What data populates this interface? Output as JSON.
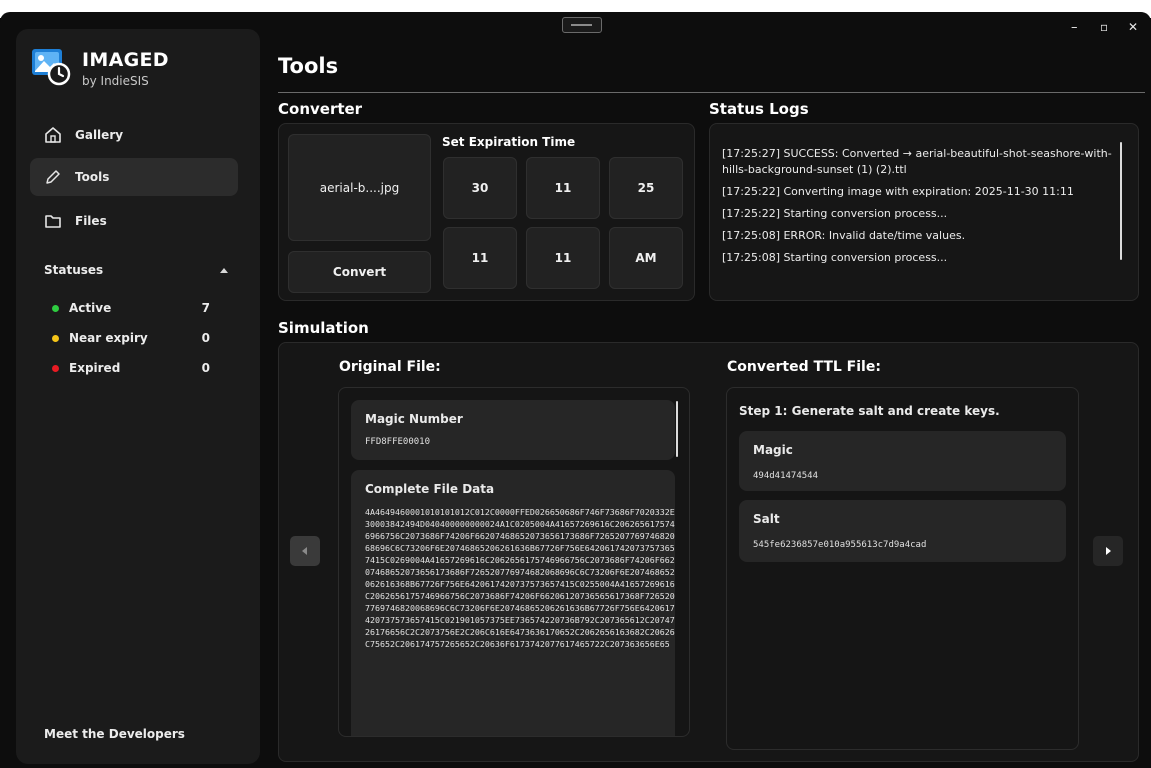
{
  "app": {
    "title": "IMAGED",
    "subtitle": "by IndieSIS"
  },
  "window_controls": {
    "minimize": "–",
    "maximize": "▫",
    "close": "✕"
  },
  "sidebar": {
    "nav": [
      {
        "label": "Gallery",
        "icon": "home-icon"
      },
      {
        "label": "Tools",
        "icon": "pencil-icon",
        "active": true
      },
      {
        "label": "Files",
        "icon": "folder-icon"
      }
    ],
    "statuses_label": "Statuses",
    "statuses": [
      {
        "label": "Active",
        "count": "7",
        "color": "#2ecc40"
      },
      {
        "label": "Near expiry",
        "count": "0",
        "color": "#f5c518"
      },
      {
        "label": "Expired",
        "count": "0",
        "color": "#e81b23"
      }
    ],
    "footer": "Meet the Developers"
  },
  "page": {
    "title": "Tools"
  },
  "converter": {
    "title": "Converter",
    "file_name": "aerial-b....jpg",
    "convert_label": "Convert",
    "expiration_label": "Set Expiration Time",
    "fields": [
      "30",
      "11",
      "25",
      "11",
      "11",
      "AM"
    ]
  },
  "status_logs": {
    "title": "Status Logs",
    "lines": [
      "[17:25:27] SUCCESS: Converted → aerial-beautiful-shot-seashore-with-hills-background-sunset (1) (2).ttl",
      "[17:25:22] Converting image with expiration: 2025-11-30 11:11",
      "[17:25:22] Starting conversion process...",
      "[17:25:08] ERROR: Invalid date/time values.",
      "[17:25:08] Starting conversion process..."
    ]
  },
  "simulation": {
    "title": "Simulation",
    "original": {
      "title": "Original File:",
      "magic_label": "Magic Number",
      "magic_value": "FFD8FFE00010",
      "data_label": "Complete File Data",
      "data_value": "4A4649460001010101012C012C0000FFED026650686F746F73686F7020332E30003842494D040400000000024A1C0205004A41657269616C2062656175746966756C2073686F74206F66207468652073656173686F726520776974682068696C6C73206F6E20746865206261636B67726F756E6420617420737573657415C0269004A41657269616C2062656175746966756C2073686F74206F66207468652073656173686F726520776974682068696C6C73206F6E207468652062616368B67726F756E6420617420737573657415C0255004A41657269616C2062656175746966756C2073686F74206F66206120736565617368F7265207769746820068696C6C73206F6E20746865206261636B67726F756E6420617420737573657415C021901057375EE736574220736B792C207365612C2074726176656C2C2073756E2C206C616E6473636170652C2062656163682C20626C75652C206174757265652C20636F6173742077617465722C207363656E65"
    },
    "converted": {
      "title": "Converted TTL File:",
      "step": "Step 1: Generate salt and create keys.",
      "magic_label": "Magic",
      "magic_value": "494d41474544",
      "salt_label": "Salt",
      "salt_value": "545fe6236857e010a955613c7d9a4cad"
    }
  }
}
